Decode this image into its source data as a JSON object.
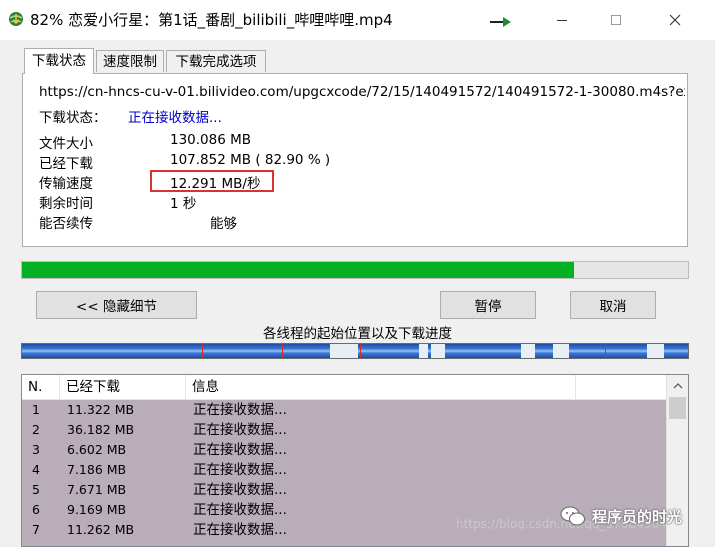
{
  "window": {
    "title": "82% 恋爱小行星：第1话_番剧_bilibili_哔哩哔哩.mp4",
    "icons": [
      "globe-download-icon",
      "arrow-right-icon",
      "minimize-icon",
      "maximize-icon",
      "close-icon"
    ]
  },
  "tabs": [
    "下载状态",
    "速度限制",
    "下载完成选项"
  ],
  "status": {
    "url": "https://cn-hncs-cu-v-01.bilivideo.com/upgcxcode/72/15/140491572/140491572-1-30080.m4s?ex",
    "status_label": "下载状态：",
    "status_value": "正在接收数据...",
    "file_size_label": "文件大小",
    "file_size_value": "130.086  MB",
    "downloaded_label": "已经下载",
    "downloaded_value": "107.852  MB  ( 82.90 % )",
    "speed_label": "传输速度",
    "speed_value": "12.291  MB/秒",
    "remaining_label": "剩余时间",
    "remaining_value": "1 秒",
    "resume_label": "能否续传",
    "resume_value": "能够"
  },
  "progress": {
    "percent": 82.9,
    "color": "#06b025"
  },
  "buttons": {
    "hide_details": "<< 隐藏细节",
    "pause": "暂停",
    "cancel": "取消"
  },
  "threads": {
    "title": "各线程的起始位置以及下载进度"
  },
  "list": {
    "columns": [
      "N.",
      "已经下载",
      "信息"
    ],
    "rows": [
      {
        "n": "1",
        "downloaded": "11.322  MB",
        "info": "正在接收数据..."
      },
      {
        "n": "2",
        "downloaded": "36.182  MB",
        "info": "正在接收数据..."
      },
      {
        "n": "3",
        "downloaded": "6.602  MB",
        "info": "正在接收数据..."
      },
      {
        "n": "4",
        "downloaded": "7.186  MB",
        "info": "正在接收数据..."
      },
      {
        "n": "5",
        "downloaded": "7.671  MB",
        "info": "正在接收数据..."
      },
      {
        "n": "6",
        "downloaded": "9.169  MB",
        "info": "正在接收数据..."
      },
      {
        "n": "7",
        "downloaded": "11.262  MB",
        "info": "正在接收数据..."
      }
    ],
    "row_color": "#b8adb9"
  },
  "watermark": {
    "url_text": "https://blog.csdn.net/qq_37084904",
    "brand": "程序员的时光"
  }
}
